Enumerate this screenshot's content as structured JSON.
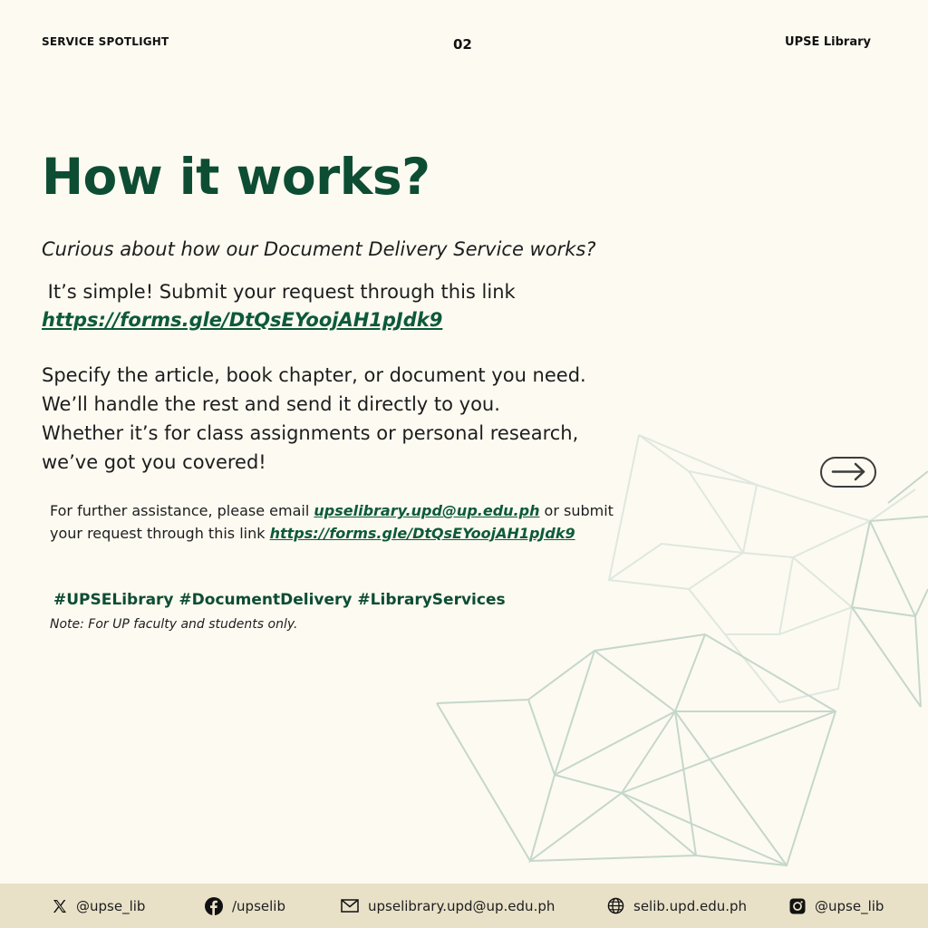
{
  "header": {
    "section": "SERVICE SPOTLIGHT",
    "page_number": "02",
    "brand": "UPSE Library"
  },
  "main": {
    "title": "How it works?",
    "intro": "Curious about how our Document Delivery Service works?",
    "simple_text": " It’s simple! Submit your request through this link",
    "request_link": "https://forms.gle/DtQsEYoojAH1pJdk9",
    "steps": [
      "Specify the article, book chapter, or document you need.",
      "We’ll handle the rest and send it directly to you.",
      "Whether it’s for class assignments or personal research,",
      "we’ve got you covered!"
    ],
    "assist_prefix": "For further assistance, please email ",
    "assist_email": "upselibrary.upd@up.edu.ph",
    "assist_middle": " or submit",
    "assist_line2_prefix": "your request through this link ",
    "assist_link": "https://forms.gle/DtQsEYoojAH1pJdk9",
    "hashtags": "#UPSELibrary #DocumentDelivery #LibraryServices",
    "note": "Note: For UP faculty and students only."
  },
  "icons": {
    "arrow": "arrow-right-icon",
    "x": "x-logo-icon",
    "facebook": "facebook-icon",
    "email": "envelope-icon",
    "web": "globe-icon",
    "instagram": "instagram-icon"
  },
  "colors": {
    "background": "#fdfaf1",
    "accent_green": "#0d4d33",
    "footer_bg": "#e8e1c8",
    "pattern_lines": "#c5d7cb"
  },
  "footer": {
    "x_handle": "@upse_lib",
    "facebook": "/upselib",
    "email": "upselibrary.upd@up.edu.ph",
    "website": "selib.upd.edu.ph",
    "instagram": "@upse_lib"
  }
}
